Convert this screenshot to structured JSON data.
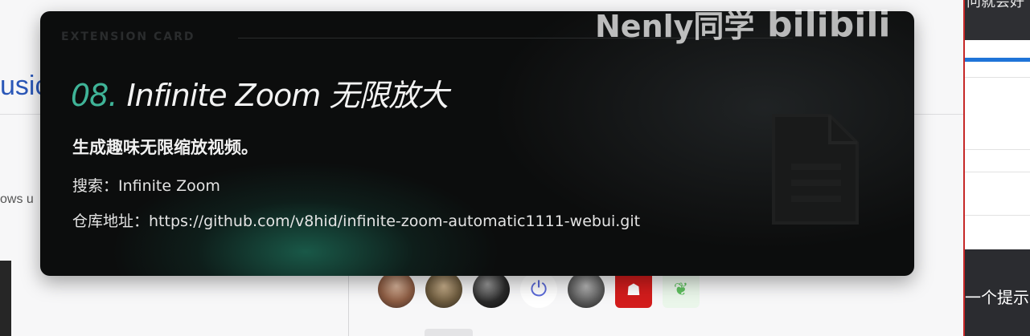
{
  "background_page": {
    "title_fragment": "usic",
    "subtitle_fragment": "ows u"
  },
  "avatars": [
    {
      "name": "avatar-1"
    },
    {
      "name": "avatar-2"
    },
    {
      "name": "avatar-3"
    },
    {
      "name": "avatar-power",
      "icon": "power-icon"
    },
    {
      "name": "avatar-5"
    },
    {
      "name": "avatar-6",
      "icon": "ghost-icon"
    },
    {
      "name": "avatar-7",
      "icon": "leaf-icon"
    }
  ],
  "right_panel": {
    "top_text": "问就会好",
    "bottom_text": "一个提示"
  },
  "card": {
    "label": "Extension Card",
    "number": "08.",
    "title": "Infinite Zoom 无限放大",
    "subtitle": "生成趣味无限缩放视频。",
    "search_line": "搜索：Infinite Zoom",
    "repo_line": "仓库地址：https://github.com/v8hid/infinite-zoom-automatic1111-webui.git",
    "accent_color": "#3fb397",
    "icon": "document-icon"
  },
  "watermark": {
    "user": "Nenly同学",
    "brand": "bilibili"
  }
}
